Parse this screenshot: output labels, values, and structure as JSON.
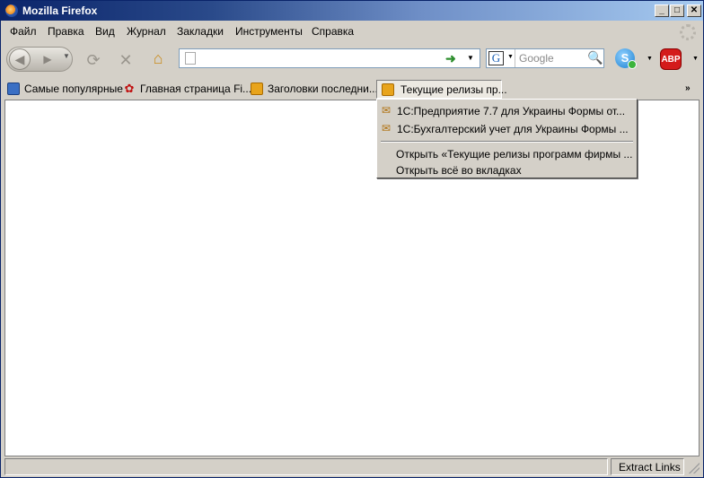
{
  "window": {
    "title": "Mozilla Firefox",
    "controls": {
      "minimize": "_",
      "maximize": "□",
      "close": "✕"
    }
  },
  "menubar": {
    "items": [
      "Файл",
      "Правка",
      "Вид",
      "Журнал",
      "Закладки",
      "Инструменты",
      "Справка"
    ]
  },
  "navbar": {
    "back_icon": "back-arrow-icon",
    "forward_icon": "forward-arrow-icon",
    "url_value": "",
    "search_engine": "G",
    "search_placeholder": "Google",
    "addons": [
      "skype-icon",
      "adblock-plus-icon"
    ],
    "abp_label": "ABP"
  },
  "bookmarks": {
    "items": [
      {
        "label": "Самые популярные",
        "icon": "popular-icon"
      },
      {
        "label": "Главная страница Fi...",
        "icon": "firefox-icon"
      },
      {
        "label": "Заголовки последни...",
        "icon": "rss-folder-icon"
      },
      {
        "label": "Текущие релизы пр...",
        "icon": "rss-folder-icon"
      }
    ],
    "overflow": "»"
  },
  "popup": {
    "items": [
      "1С:Предприятие 7.7 для Украины Формы от...",
      "1С:Бухгалтерский учет для Украины Формы ..."
    ],
    "actions": [
      "Открыть «Текущие релизы программ фирмы ...",
      "Открыть всё во вкладках"
    ]
  },
  "statusbar": {
    "text": "",
    "extension": "Extract Links"
  },
  "colors": {
    "titlebar_start": "#0a246a",
    "titlebar_end": "#a6caf0",
    "chrome": "#d4d0c8"
  }
}
